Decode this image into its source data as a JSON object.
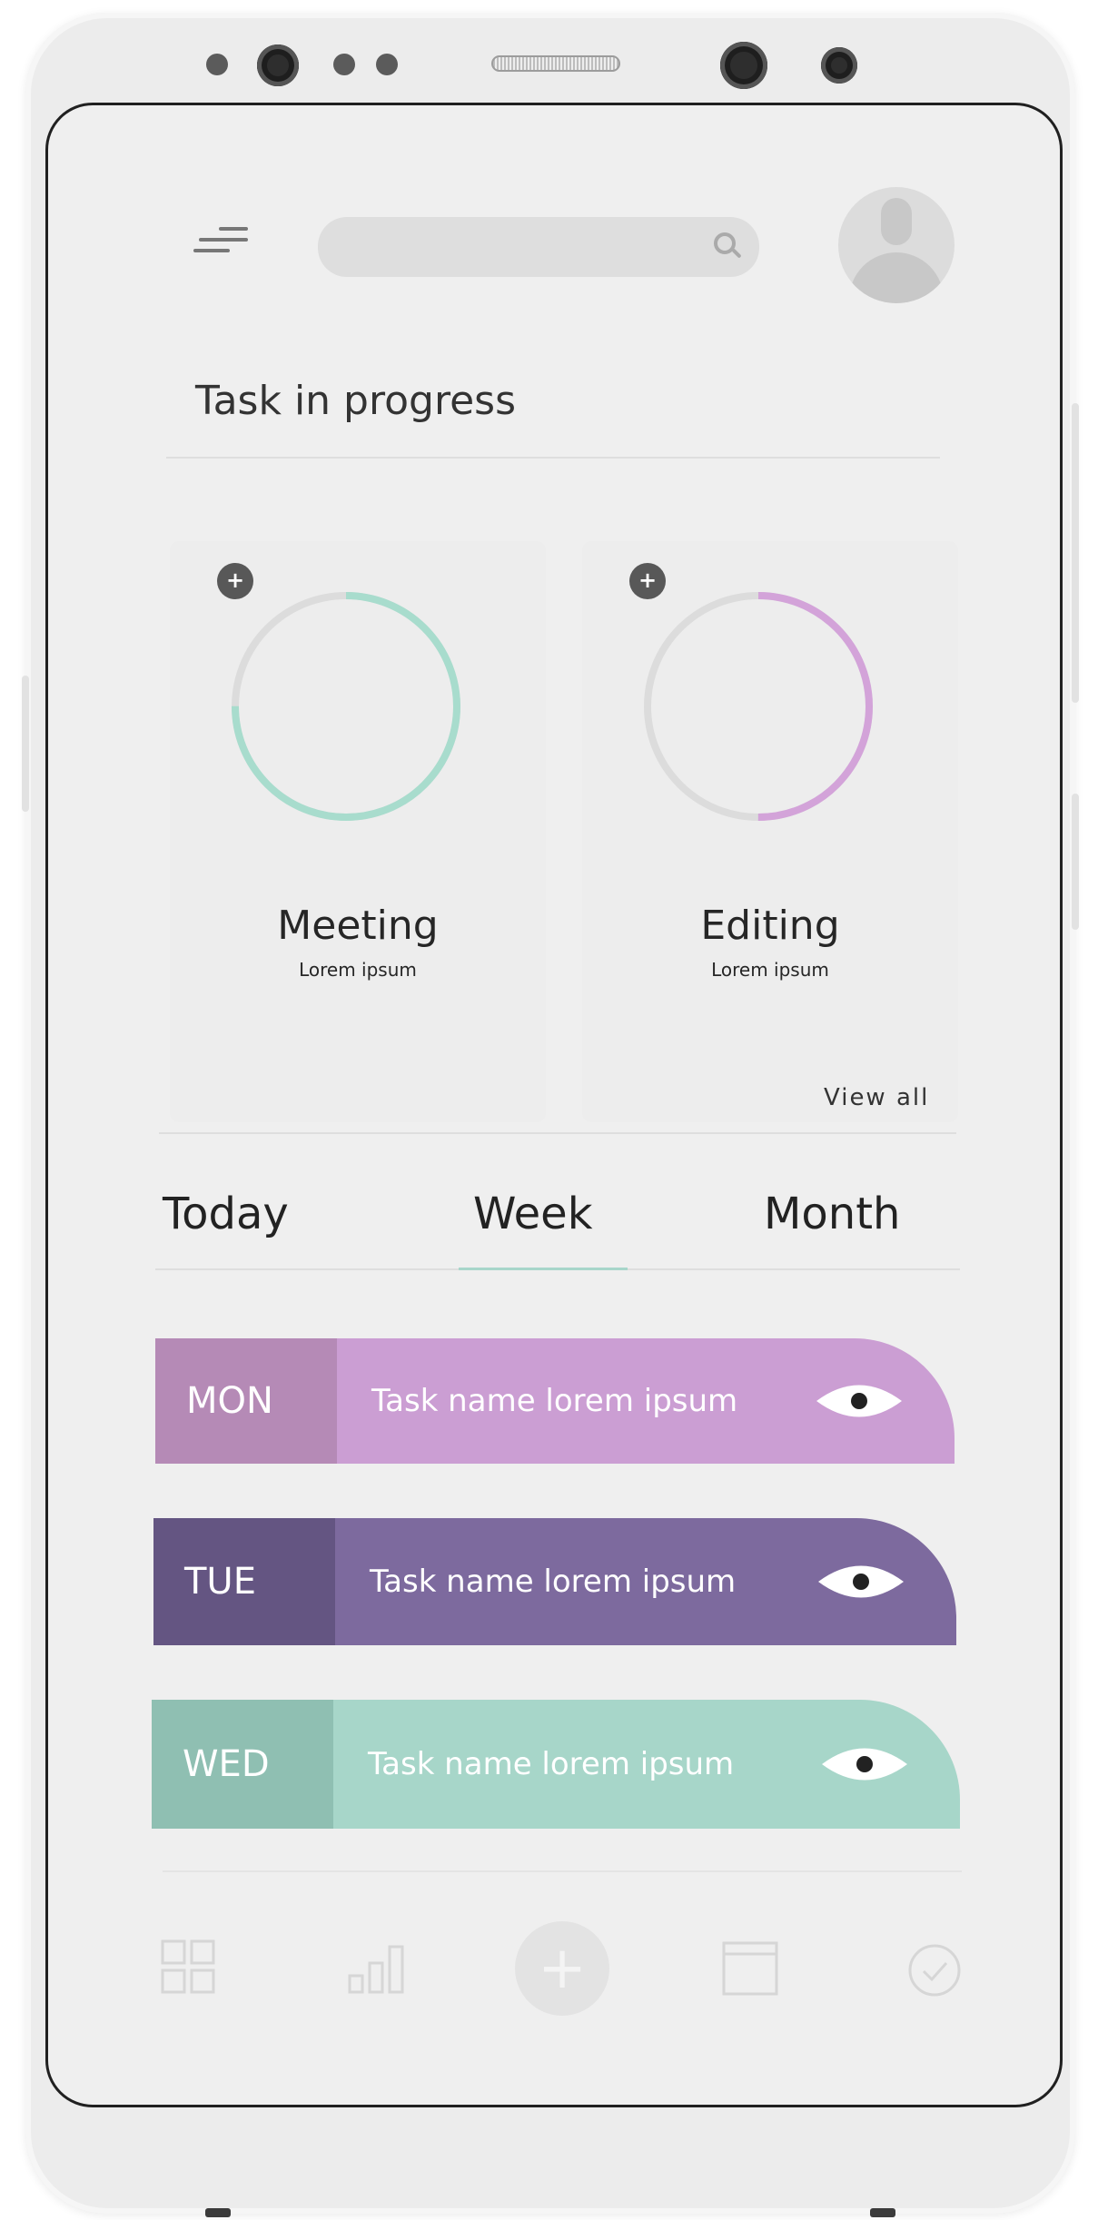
{
  "app": {
    "section_title": "Task in progress",
    "view_all": "View all"
  },
  "progress_cards": [
    {
      "name": "Meeting",
      "subtitle": "Lorem ipsum",
      "progress": 0.75,
      "color": "#a8dccd",
      "plus": "+"
    },
    {
      "name": "Editing",
      "subtitle": "Lorem ipsum",
      "progress": 0.5,
      "color": "#d3a3d9",
      "plus": "+"
    }
  ],
  "tabs": [
    {
      "label": "Today",
      "active": false
    },
    {
      "label": "Week",
      "active": true
    },
    {
      "label": "Month",
      "active": false
    }
  ],
  "tasks": [
    {
      "day": "MON",
      "name": "Task name lorem ipsum",
      "color": "#cb9ed3",
      "day_color": "#b58ab6"
    },
    {
      "day": "TUE",
      "name": "Task name lorem ipsum",
      "color": "#7d6a9e",
      "day_color": "#645582"
    },
    {
      "day": "WED",
      "name": "Task name lorem ipsum",
      "color": "#a7d6c9",
      "day_color": "#8fbfb2"
    }
  ],
  "nav": {
    "icons": [
      "grid-icon",
      "bar-chart-icon",
      "add-icon",
      "calendar-icon",
      "check-circle-icon"
    ],
    "fab_label": "+"
  },
  "colors": {
    "accent_teal": "#a8d6ca",
    "track_gray": "#dcdcdc"
  }
}
